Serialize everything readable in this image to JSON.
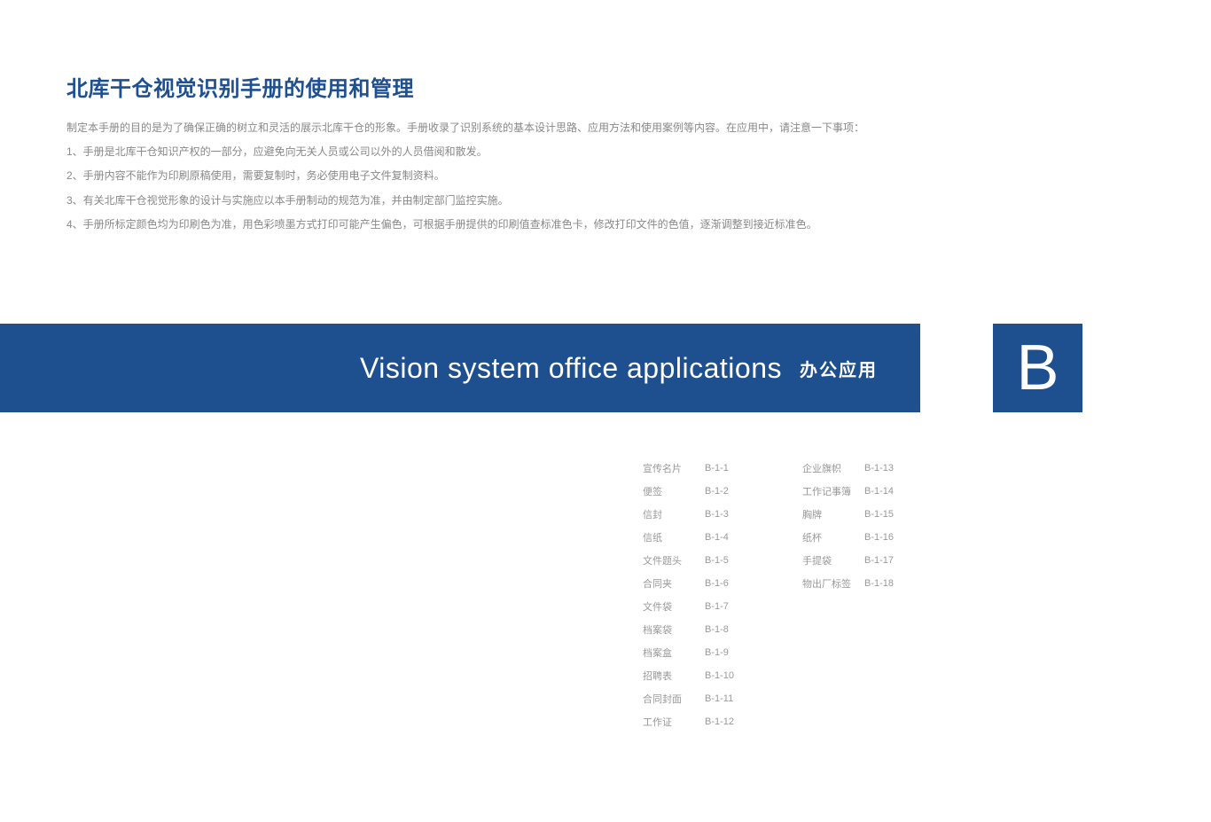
{
  "title": "北库干仓视觉识别手册的使用和管理",
  "intro": "制定本手册的目的是为了确保正确的树立和灵活的展示北库干仓的形象。手册收录了识别系统的基本设计思路、应用方法和使用案例等内容。在应用中，请注意一下事项：",
  "rules": [
    "1、手册是北库干仓知识产权的一部分，应避免向无关人员或公司以外的人员借阅和散发。",
    "2、手册内容不能作为印刷原稿使用，需要复制时，务必使用电子文件复制资料。",
    "3、有关北库干仓视觉形象的设计与实施应以本手册制动的规范为准，并由制定部门监控实施。",
    "4、手册所标定颜色均为印刷色为准，用色彩喷墨方式打印可能产生偏色，可根据手册提供的印刷值查标准色卡，修改打印文件的色值，逐渐调整到接近标准色。"
  ],
  "banner": {
    "en": "Vision system office applications",
    "cn": "办公应用",
    "letter": "B"
  },
  "toc_col1": [
    {
      "name": "宣传名片",
      "code": "B-1-1"
    },
    {
      "name": "便签",
      "code": "B-1-2"
    },
    {
      "name": "信封",
      "code": "B-1-3"
    },
    {
      "name": "信纸",
      "code": "B-1-4"
    },
    {
      "name": "文件题头",
      "code": "B-1-5"
    },
    {
      "name": "合同夹",
      "code": "B-1-6"
    },
    {
      "name": "文件袋",
      "code": "B-1-7"
    },
    {
      "name": "档案袋",
      "code": "B-1-8"
    },
    {
      "name": "档案盒",
      "code": "B-1-9"
    },
    {
      "name": "招聘表",
      "code": "B-1-10"
    },
    {
      "name": "合同封面",
      "code": "B-1-11"
    },
    {
      "name": "工作证",
      "code": "B-1-12"
    }
  ],
  "toc_col2": [
    {
      "name": "企业旗帜",
      "code": "B-1-13"
    },
    {
      "name": "工作记事簿",
      "code": "B-1-14"
    },
    {
      "name": "胸牌",
      "code": "B-1-15"
    },
    {
      "name": "纸杯",
      "code": "B-1-16"
    },
    {
      "name": "手提袋",
      "code": "B-1-17"
    },
    {
      "name": "物出厂标签",
      "code": "B-1-18"
    }
  ]
}
